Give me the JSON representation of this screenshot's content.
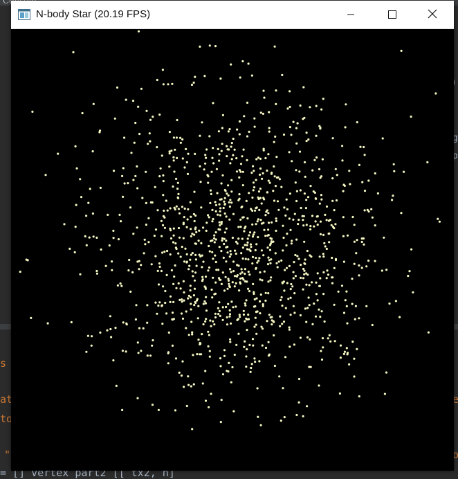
{
  "background": {
    "editor_title": "Console",
    "right_fragments": [
      ")",
      "g",
      "p"
    ],
    "code_fragments": [
      "s",
      "at",
      "to",
      "\"",
      "= [] vertex part2 [[ tx2, n]",
      "e",
      "o"
    ]
  },
  "window": {
    "title": "N-body Star (20.19 FPS)",
    "icon": "app-window-icon",
    "buttons": {
      "minimize": "minimize-icon",
      "maximize": "maximize-icon",
      "close": "close-icon"
    }
  },
  "simulation": {
    "star_color": "#f4f5c2",
    "background_color": "#000000",
    "star_count": 1200,
    "fps": 20.19
  }
}
